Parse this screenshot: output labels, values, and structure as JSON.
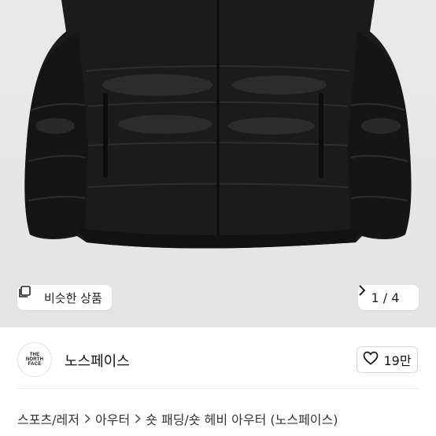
{
  "image": {
    "similar_label": "비슷한 상품",
    "page_current": "1",
    "page_total": "4",
    "page_separator": "/"
  },
  "seller": {
    "logo_lines": [
      "THE",
      "NORTH",
      "FACE"
    ],
    "name": "노스페이스",
    "like_count": "19만"
  },
  "breadcrumb": {
    "items": [
      "스포츠/레저",
      "아우터",
      "숏 패딩/숏 헤비 아우터 (노스페이스)"
    ]
  },
  "colors": {
    "image_bg": "#e7e7e7",
    "jacket": "#1b1b1b"
  },
  "icons": {
    "similar": "copy-search-icon",
    "chevron": "chevron-right-icon",
    "heart": "heart-outline-icon"
  }
}
